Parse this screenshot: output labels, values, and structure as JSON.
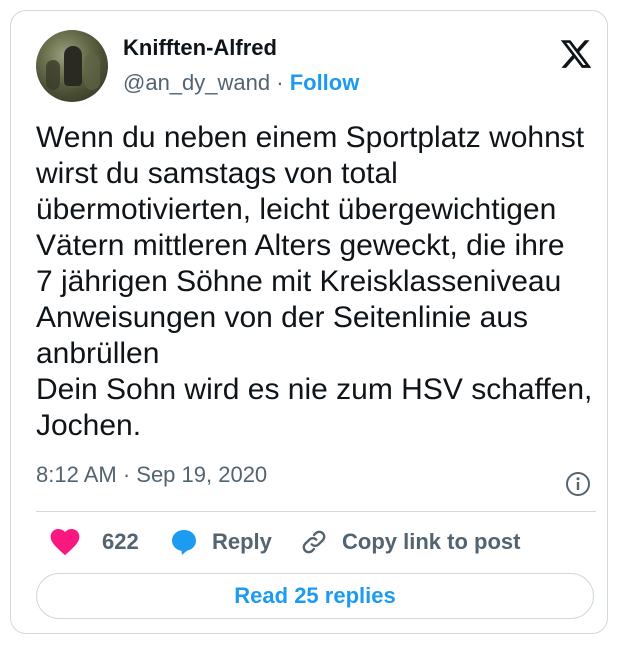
{
  "user": {
    "name": "Knifften-Alfred",
    "handle": "@an_dy_wand",
    "separator": "·",
    "follow_label": "Follow"
  },
  "post": {
    "text": "Wenn du neben einem Sportplatz wohnst\nwirst du samstags von total\nübermotivierten, leicht übergewichtigen\nVätern mittleren Alters geweckt, die ihre\n7 jährigen Söhne mit Kreisklasseniveau\nAnweisungen von der Seitenlinie aus\nanbrüllen\nDein Sohn wird es nie zum HSV schaffen,\nJochen.",
    "timestamp": "8:12 AM · Sep 19, 2020"
  },
  "actions": {
    "like_count": "622",
    "reply_label": "Reply",
    "copy_label": "Copy link to post"
  },
  "footer": {
    "read_replies_label": "Read 25 replies"
  },
  "colors": {
    "accent": "#1d9bf0",
    "like": "#f91880",
    "muted": "#536471",
    "text": "#0f1419",
    "border": "#cfd9de"
  },
  "icons": {
    "platform_logo": "x-logo-icon",
    "info": "info-icon",
    "like": "heart-icon",
    "reply": "speech-bubble-icon",
    "copy": "link-icon"
  }
}
